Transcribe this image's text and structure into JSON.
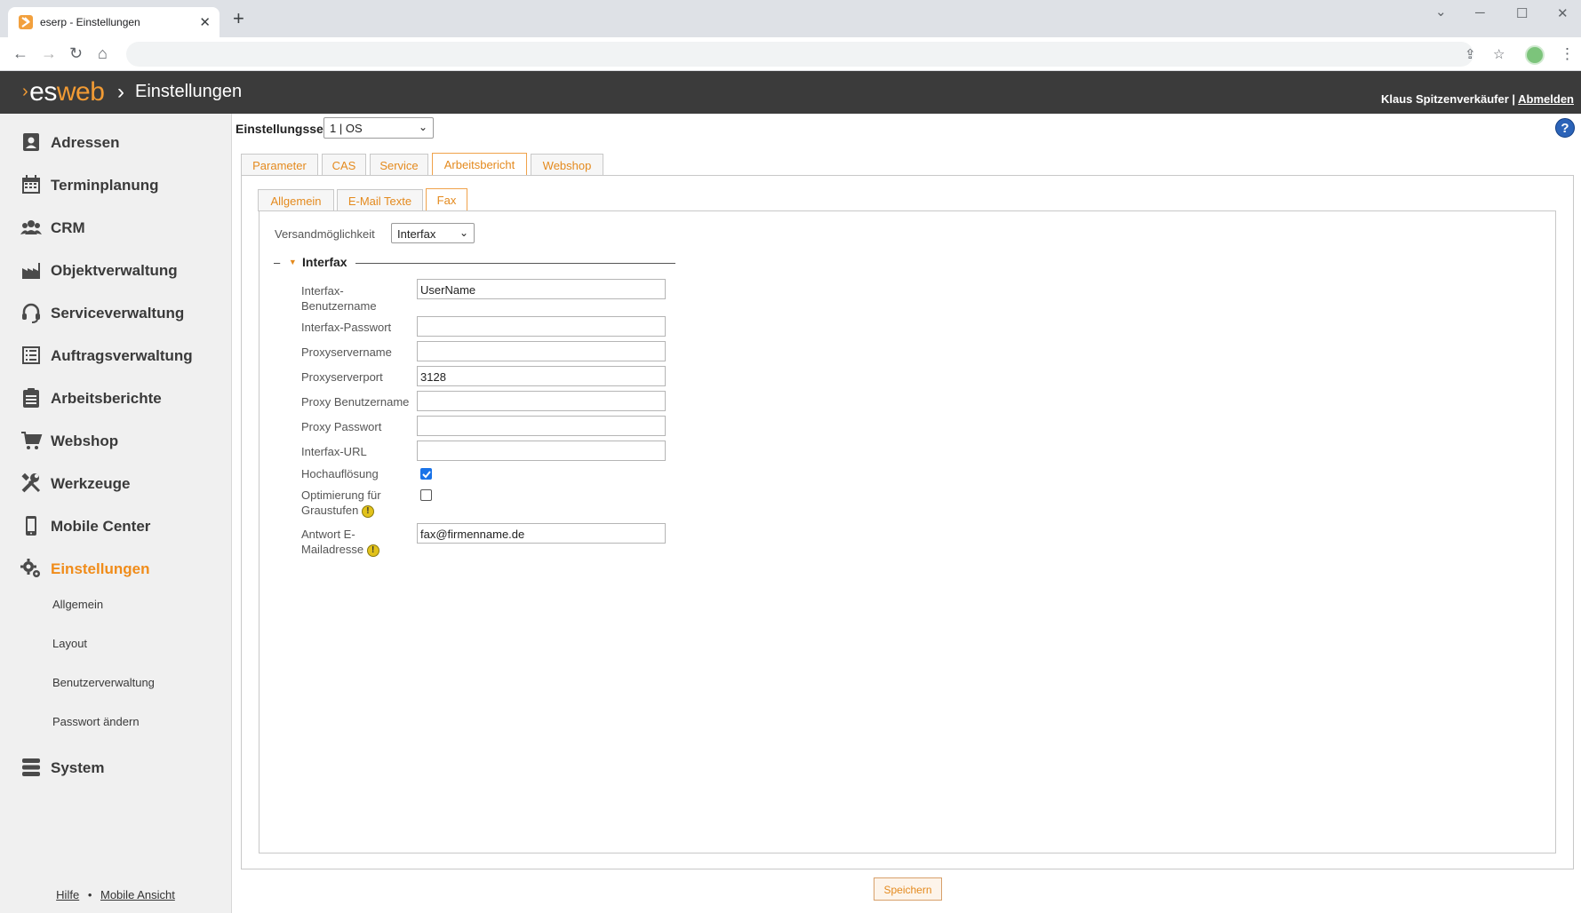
{
  "browser": {
    "tab_title": "eserp - Einstellungen",
    "close": "✕",
    "new_tab": "+",
    "win_min": "─",
    "win_max": "☐",
    "win_close": "✕",
    "icons": [
      "back-arrow-icon",
      "forward-arrow-icon",
      "reload-icon",
      "home-icon",
      "share-icon",
      "star-icon",
      "menu-dots-icon"
    ]
  },
  "header": {
    "logo_es": "es",
    "logo_web": "web",
    "logo_arrow": "›",
    "sep": "›",
    "title": "Einstellungen",
    "user": "Klaus Spitzenverkäufer",
    "divider": " | ",
    "logout": "Abmelden"
  },
  "sidebar": {
    "items": [
      {
        "label": "Adressen",
        "icon": "address-book-icon"
      },
      {
        "label": "Terminplanung",
        "icon": "calendar-icon"
      },
      {
        "label": "CRM",
        "icon": "users-icon"
      },
      {
        "label": "Objektverwaltung",
        "icon": "factory-icon"
      },
      {
        "label": "Serviceverwaltung",
        "icon": "headset-icon"
      },
      {
        "label": "Auftragsverwaltung",
        "icon": "list-icon"
      },
      {
        "label": "Arbeitsberichte",
        "icon": "clipboard-icon"
      },
      {
        "label": "Webshop",
        "icon": "cart-icon"
      },
      {
        "label": "Werkzeuge",
        "icon": "tools-icon"
      },
      {
        "label": "Mobile Center",
        "icon": "mobile-icon"
      },
      {
        "label": "Einstellungen",
        "icon": "gears-icon"
      },
      {
        "label": "System",
        "icon": "server-icon"
      }
    ],
    "subitems": [
      "Allgemein",
      "Layout",
      "Benutzerverwaltung",
      "Passwort ändern"
    ],
    "footer_help": "Hilfe",
    "footer_dot": "•",
    "footer_mobile": "Mobile Ansicht"
  },
  "main": {
    "set_label": "Einstellungsset",
    "set_value": "1 | OS",
    "help": "?",
    "tabs": [
      "Parameter",
      "CAS",
      "Service",
      "Arbeitsbericht",
      "Webshop"
    ],
    "active_tab": "Arbeitsbericht",
    "subtabs": [
      "Allgemein",
      "E-Mail Texte",
      "Fax"
    ],
    "active_subtab": "Fax",
    "versand_label": "Versandmöglichkeit",
    "versand_value": "Interfax",
    "section_toggle": "–",
    "section_arrow": "▼",
    "section_title": "Interfax",
    "fields": {
      "username_label": "Interfax-\nBenutzername",
      "username_value": "UserName",
      "password_label": "Interfax-Passwort",
      "password_value": "",
      "proxyname_label": "Proxyservername",
      "proxyname_value": "",
      "proxyport_label": "Proxyserverport",
      "proxyport_value": "3128",
      "proxyuser_label": "Proxy Benutzername",
      "proxyuser_value": "",
      "proxypass_label": "Proxy Passwort",
      "proxypass_value": "",
      "url_label": "Interfax-URL",
      "url_value": "",
      "highres_label": "Hochauflösung",
      "highres_checked": true,
      "gray_label_1": "Optimierung für",
      "gray_label_2": "Graustufen",
      "gray_checked": false,
      "reply_label_1": "Antwort E-",
      "reply_label_2": "Mailadresse",
      "reply_value": "fax@firmenname.de",
      "warn": "!"
    },
    "save": "Speichern"
  }
}
